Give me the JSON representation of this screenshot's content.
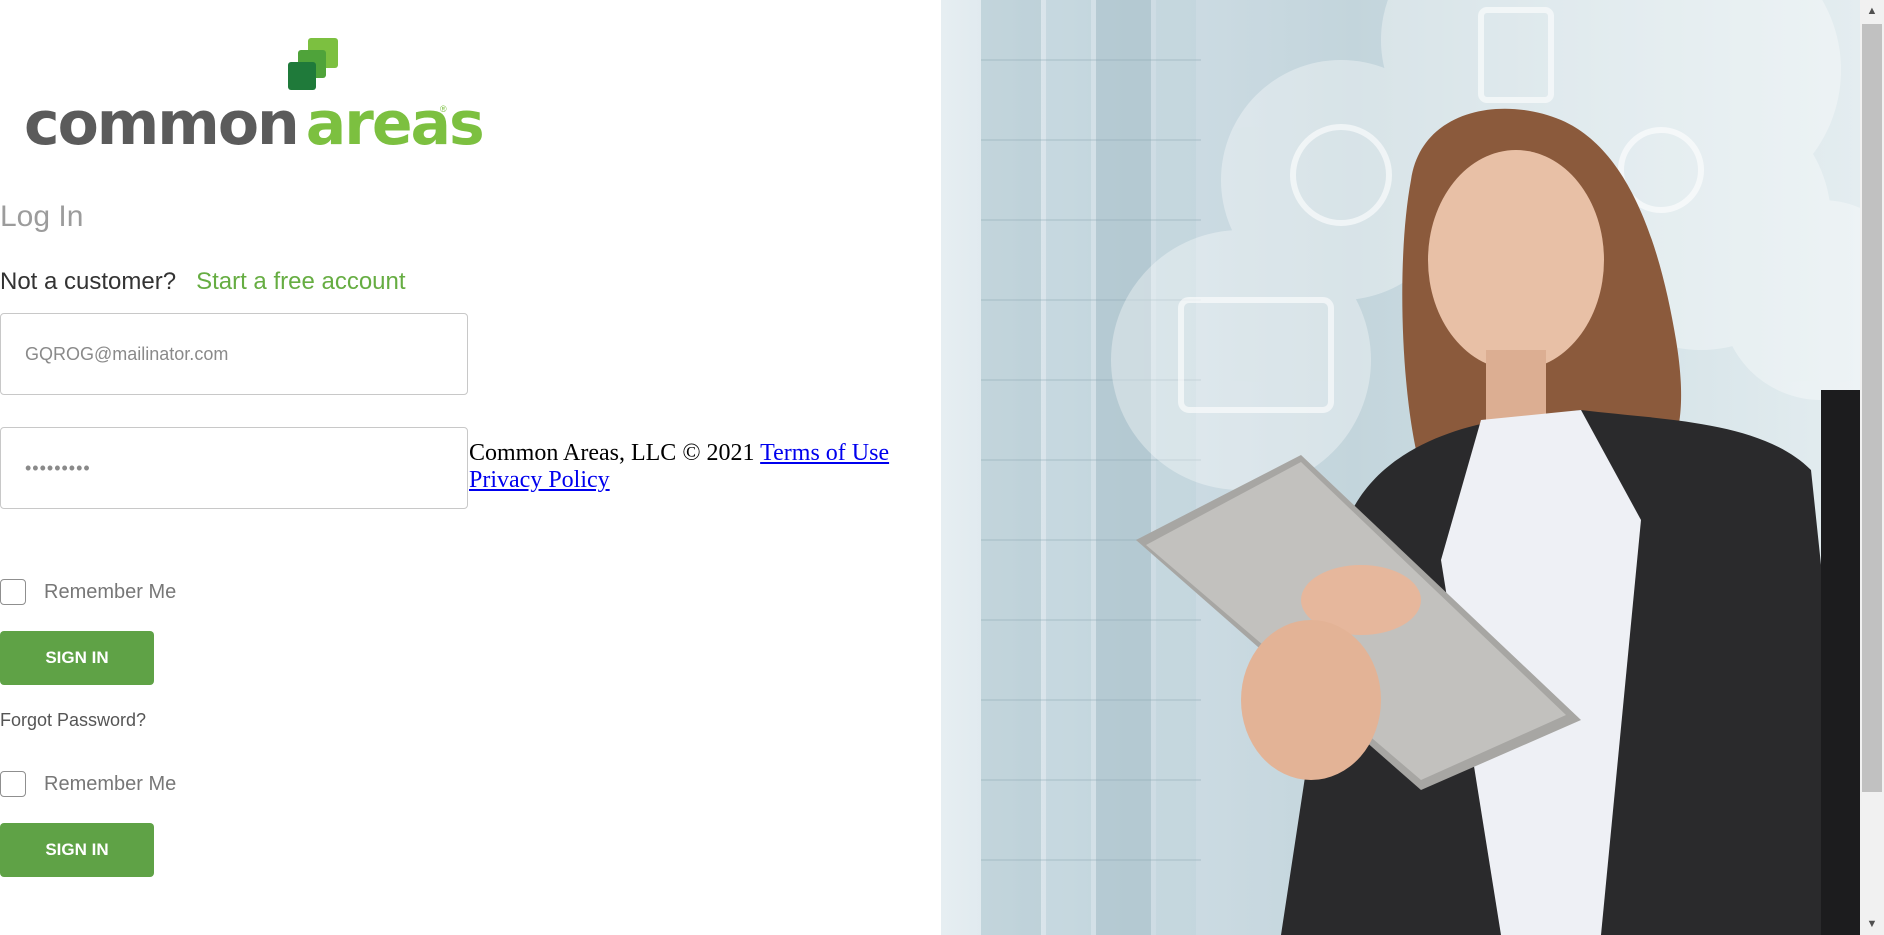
{
  "logo": {
    "word1": "common",
    "word2": "areas",
    "tm": "®"
  },
  "login": {
    "title": "Log In",
    "not_customer": "Not a customer?",
    "signup_link": "Start a free account",
    "email_value": "GQROG@mailinator.com",
    "password_value": "•••••••••",
    "remember_me_label": "Remember Me",
    "signin_label": "SIGN IN",
    "forgot_password": "Forgot Password?"
  },
  "footer": {
    "copyright": "Common Areas, LLC © 2021",
    "terms": "Terms of Use",
    "privacy": "Privacy Policy"
  },
  "scrollbar": {
    "up_arrow": "▲",
    "down_arrow": "▼"
  },
  "colors": {
    "brand_green": "#7cc040",
    "button_green": "#5fa246",
    "logo_gray": "#5b5b5b"
  }
}
